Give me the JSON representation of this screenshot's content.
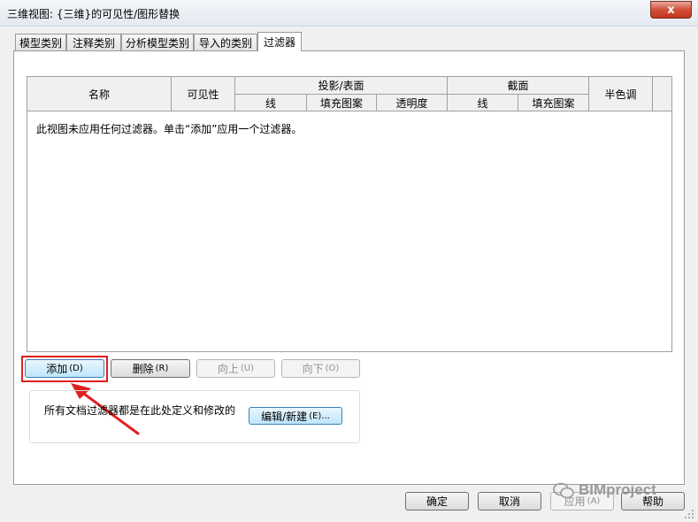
{
  "window": {
    "title": "三维视图: {三维}的可见性/图形替换",
    "close_glyph": "x"
  },
  "tabs": [
    {
      "label": "模型类别"
    },
    {
      "label": "注释类别"
    },
    {
      "label": "分析模型类别"
    },
    {
      "label": "导入的类别"
    },
    {
      "label": "过滤器"
    }
  ],
  "grid": {
    "headers": {
      "name": "名称",
      "visibility": "可见性",
      "projection_surface": "投影/表面",
      "line": "线",
      "fill_pattern": "填充图案",
      "transparency": "透明度",
      "cut": "截面",
      "cut_line": "线",
      "cut_fill_pattern": "填充图案",
      "halftone": "半色调"
    },
    "empty_message": "此视图未应用任何过滤器。单击“添加”应用一个过滤器。"
  },
  "filter_buttons": {
    "add": {
      "label": "添加",
      "shortcut": "(D)"
    },
    "delete": {
      "label": "删除",
      "shortcut": "(R)"
    },
    "up": {
      "label": "向上",
      "shortcut": "(U)"
    },
    "down": {
      "label": "向下",
      "shortcut": "(O)"
    }
  },
  "group": {
    "text": "所有文档过滤器都是在此处定义和修改的",
    "edit_new": {
      "label": "编辑/新建",
      "shortcut": "(E)..."
    }
  },
  "footer": {
    "ok": "确定",
    "cancel": "取消",
    "apply": "应用",
    "apply_shortcut": "(A)",
    "help": "帮助"
  },
  "watermark": {
    "text": "BIMproject"
  },
  "colors": {
    "highlight": "#e02020",
    "close_button": "#c4341c"
  }
}
